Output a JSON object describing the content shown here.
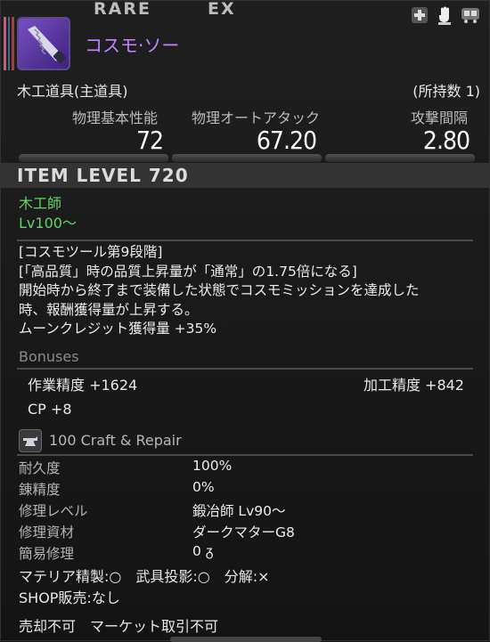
{
  "header": {
    "rarity_tags": [
      "RARE",
      "EX"
    ],
    "item_name": "コスモ·ソー",
    "icons": [
      "plus-cross-icon",
      "glove-hand-icon",
      "cart-icon"
    ],
    "colors": {
      "name": "#c184ff",
      "rarity_stripes": [
        "#c45d7a",
        "#2e6e9e",
        "#a04040"
      ]
    }
  },
  "item_type": "木工道具(主道具)",
  "owned": "(所持数 1)",
  "stats": [
    {
      "label": "物理基本性能",
      "value": "72"
    },
    {
      "label": "物理オートアタック",
      "value": "67.20"
    },
    {
      "label": "攻撃間隔",
      "value": "2.80"
    }
  ],
  "item_level": "ITEM LEVEL 720",
  "class_job": "木工師",
  "level_req": "Lv100～",
  "description": [
    "[コスモツール第9段階]",
    "[「高品質」時の品質上昇量が「通常」の1.75倍になる]",
    "開始時から終了まで装備した状態でコスモミッションを達成した",
    "時、報酬獲得量が上昇する。",
    "ムーンクレジット獲得量 +35%"
  ],
  "bonuses": {
    "title": "Bonuses",
    "left": "作業精度 +1624",
    "right": "加工精度 +842",
    "cp": "CP +8"
  },
  "craft": {
    "label": "100 Craft & Repair",
    "icon": "anvil-icon"
  },
  "repair_info": [
    {
      "label": "耐久度",
      "value": "100%"
    },
    {
      "label": "錬精度",
      "value": "0%"
    },
    {
      "label": "修理レベル",
      "value": "鍛冶師 Lv90～"
    },
    {
      "label": "修理資材",
      "value": "ダークマターG8"
    },
    {
      "label": "簡易修理",
      "value": "0 ᵹ"
    }
  ],
  "flags_line": "マテリア精製:○　武具投影:○　分解:×",
  "shop_line": "SHOP販売:なし",
  "footer_line": "売却不可　マーケット取引不可"
}
